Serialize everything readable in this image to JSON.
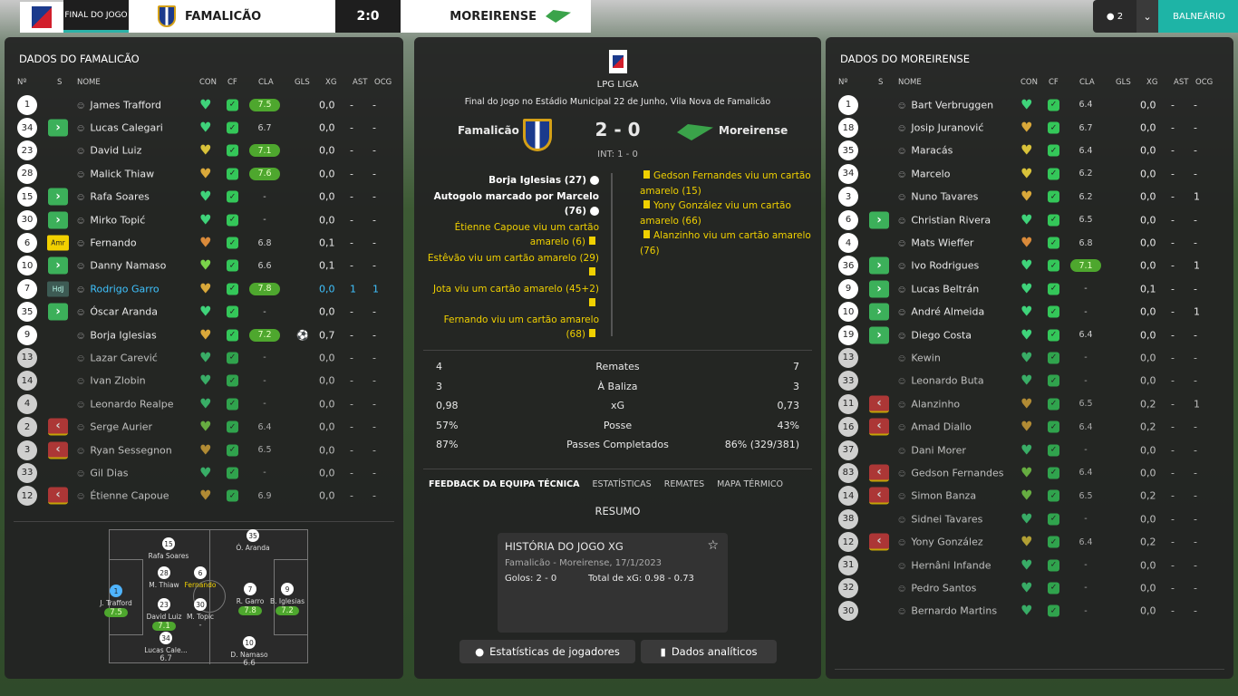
{
  "top": {
    "final_label": "FINAL DO JOGO",
    "home": "FAMALICÃO",
    "score": "2:0",
    "away": "MOREIRENSE",
    "user_count": "2",
    "balneario": "BALNEÁRIO"
  },
  "left": {
    "title": "DADOS DO FAMALICÃO",
    "headers": [
      "Nº",
      "S",
      "NOME",
      "CON",
      "CF",
      "CLA",
      "GLS",
      "XG",
      "AST",
      "OCG"
    ],
    "players": [
      {
        "n": "1",
        "s": "",
        "name": "James Trafford",
        "heart": "#3fd37a",
        "cla": "7.5",
        "g": true,
        "gls": "",
        "xg": "0,0",
        "ast": "-",
        "ocg": "-"
      },
      {
        "n": "34",
        "s": "in",
        "name": "Lucas Calegari",
        "heart": "#3fd37a",
        "cla": "6.7",
        "g": false,
        "gls": "",
        "xg": "0,0",
        "ast": "-",
        "ocg": "-"
      },
      {
        "n": "23",
        "s": "",
        "name": "David Luiz",
        "heart": "#d9c23a",
        "cla": "7.1",
        "g": true,
        "gls": "",
        "xg": "0,0",
        "ast": "-",
        "ocg": "-"
      },
      {
        "n": "28",
        "s": "",
        "name": "Malick Thiaw",
        "heart": "#d9a83a",
        "cla": "7.6",
        "g": true,
        "gls": "",
        "xg": "0,0",
        "ast": "-",
        "ocg": "-"
      },
      {
        "n": "15",
        "s": "in",
        "name": "Rafa Soares",
        "heart": "#3fd37a",
        "cla": "-",
        "g": false,
        "gls": "",
        "xg": "0,0",
        "ast": "-",
        "ocg": "-"
      },
      {
        "n": "30",
        "s": "in",
        "name": "Mirko Topić",
        "heart": "#3fd37a",
        "cla": "-",
        "g": false,
        "gls": "",
        "xg": "0,0",
        "ast": "-",
        "ocg": "-"
      },
      {
        "n": "6",
        "s": "amr",
        "name": "Fernando",
        "heart": "#d98a3a",
        "cla": "6.8",
        "g": false,
        "gls": "",
        "xg": "0,1",
        "ast": "-",
        "ocg": "-"
      },
      {
        "n": "10",
        "s": "in",
        "name": "Danny Namaso",
        "heart": "#7ad34a",
        "cla": "6.6",
        "g": false,
        "gls": "",
        "xg": "0,1",
        "ast": "-",
        "ocg": "-"
      },
      {
        "n": "7",
        "s": "hdj",
        "name": "Rodrigo Garro",
        "heart": "#d9a83a",
        "cla": "7.8",
        "g": true,
        "gls": "",
        "xg": "0,0",
        "ast": "1",
        "ocg": "1",
        "hl": true
      },
      {
        "n": "35",
        "s": "in",
        "name": "Óscar Aranda",
        "heart": "#3fd37a",
        "cla": "-",
        "g": false,
        "gls": "",
        "xg": "0,0",
        "ast": "-",
        "ocg": "-"
      },
      {
        "n": "9",
        "s": "",
        "name": "Borja Iglesias",
        "heart": "#d9a83a",
        "cla": "7.2",
        "g": true,
        "gls": "⚽",
        "xg": "0,7",
        "ast": "-",
        "ocg": "-"
      },
      {
        "n": "13",
        "s": "",
        "name": "Lazar Carević",
        "heart": "#3fd37a",
        "cla": "-",
        "g": false,
        "gls": "",
        "xg": "0,0",
        "ast": "-",
        "ocg": "-",
        "dim": true
      },
      {
        "n": "14",
        "s": "",
        "name": "Ivan Zlobin",
        "heart": "#3fd37a",
        "cla": "-",
        "g": false,
        "gls": "",
        "xg": "0,0",
        "ast": "-",
        "ocg": "-",
        "dim": true
      },
      {
        "n": "4",
        "s": "",
        "name": "Leonardo Realpe",
        "heart": "#3fd37a",
        "cla": "-",
        "g": false,
        "gls": "",
        "xg": "0,0",
        "ast": "-",
        "ocg": "-",
        "dim": true
      },
      {
        "n": "2",
        "s": "out",
        "name": "Serge Aurier",
        "heart": "#7ad34a",
        "cla": "6.4",
        "g": false,
        "gls": "",
        "xg": "0,0",
        "ast": "-",
        "ocg": "-",
        "dim": true
      },
      {
        "n": "3",
        "s": "out",
        "name": "Ryan Sessegnon",
        "heart": "#d9a83a",
        "cla": "6.5",
        "g": false,
        "gls": "",
        "xg": "0,0",
        "ast": "-",
        "ocg": "-",
        "dim": true
      },
      {
        "n": "33",
        "s": "",
        "name": "Gil Dias",
        "heart": "#3fd37a",
        "cla": "-",
        "g": false,
        "gls": "",
        "xg": "0,0",
        "ast": "-",
        "ocg": "-",
        "dim": true
      },
      {
        "n": "12",
        "s": "out",
        "name": "Étienne Capoue",
        "heart": "#d9a83a",
        "cla": "6.9",
        "g": false,
        "gls": "",
        "xg": "0,0",
        "ast": "-",
        "ocg": "-",
        "dim": true
      }
    ],
    "pitch": [
      {
        "n": "1",
        "name": "J. Trafford",
        "r": "7.5",
        "g": true,
        "gk": true
      },
      {
        "n": "15",
        "name": "Rafa Soares",
        "r": "",
        "g": false
      },
      {
        "n": "28",
        "name": "M. Thiaw",
        "r": "",
        "g": false
      },
      {
        "n": "6",
        "name": "Fernando",
        "r": "",
        "g": false,
        "y": true
      },
      {
        "n": "35",
        "name": "Ó. Aranda",
        "r": "",
        "g": false
      },
      {
        "n": "23",
        "name": "David Luiz",
        "r": "7.1",
        "g": true
      },
      {
        "n": "30",
        "name": "M. Topic",
        "r": "-",
        "g": false
      },
      {
        "n": "7",
        "name": "R. Garro",
        "r": "7.8",
        "g": true
      },
      {
        "n": "9",
        "name": "B. Iglesias",
        "r": "7.2",
        "g": true
      },
      {
        "n": "34",
        "name": "Lucas Cale...",
        "r": "6.7",
        "g": false
      },
      {
        "n": "10",
        "name": "D. Namaso",
        "r": "6.6",
        "g": false
      }
    ]
  },
  "mid": {
    "league": "LPG LIGA",
    "venue": "Final do Jogo no Estádio Municipal 22 de Junho, Vila Nova de Famalicão",
    "home": "Famalicão",
    "score": "2 - 0",
    "away": "Moreirense",
    "ht": "INT: 1 - 0",
    "left_events": [
      {
        "text": "Borja Iglesias (27)",
        "type": "goal"
      },
      {
        "text": "Autogolo marcado por Marcelo (76)",
        "type": "og"
      },
      {
        "text": "Étienne Capoue viu um cartão amarelo (6)",
        "type": "y"
      },
      {
        "text": "Estêvão viu um cartão amarelo (29)",
        "type": "y"
      },
      {
        "text": "Jota viu um cartão amarelo (45+2)",
        "type": "y"
      },
      {
        "text": "Fernando viu um cartão amarelo (68)",
        "type": "y"
      }
    ],
    "right_events": [
      {
        "text": "Gedson Fernandes viu um cartão amarelo (15)"
      },
      {
        "text": "Yony González viu um cartão amarelo (66)"
      },
      {
        "text": "Alanzinho viu um cartão amarelo (76)"
      }
    ],
    "stats": [
      {
        "a": "4",
        "m": "Remates",
        "b": "7"
      },
      {
        "a": "3",
        "m": "À Baliza",
        "b": "3"
      },
      {
        "a": "0,98",
        "m": "xG",
        "b": "0,73"
      },
      {
        "a": "57%",
        "m": "Posse",
        "b": "43%"
      },
      {
        "a": "87%",
        "m": "Passes Completados",
        "b": "86% (329/381)"
      }
    ],
    "tabs": [
      "FEEDBACK DA EQUIPA TÉCNICA",
      "ESTATÍSTICAS",
      "REMATES",
      "MAPA TÉRMICO"
    ],
    "resumo": "RESUMO",
    "card": {
      "title": "HISTÓRIA DO JOGO XG",
      "sub": "Famalicão - Moreirense, 17/1/2023",
      "goals": "Golos: 2 - 0",
      "xg": "Total de xG: 0.98 - 0.73"
    },
    "btn1": "Estatísticas de jogadores",
    "btn2": "Dados analíticos"
  },
  "right": {
    "title": "DADOS DO MOREIRENSE",
    "players": [
      {
        "n": "1",
        "s": "",
        "name": "Bart Verbruggen",
        "heart": "#3fd37a",
        "cla": "6.4",
        "g": false,
        "xg": "0,0",
        "ast": "-",
        "ocg": "-"
      },
      {
        "n": "18",
        "s": "",
        "name": "Josip Juranović",
        "heart": "#d9a83a",
        "cla": "6.7",
        "g": false,
        "xg": "0,0",
        "ast": "-",
        "ocg": "-"
      },
      {
        "n": "35",
        "s": "",
        "name": "Maracás",
        "heart": "#d9c23a",
        "cla": "6.4",
        "g": false,
        "xg": "0,0",
        "ast": "-",
        "ocg": "-"
      },
      {
        "n": "34",
        "s": "",
        "name": "Marcelo",
        "heart": "#d9c23a",
        "cla": "6.2",
        "g": false,
        "xg": "0,0",
        "ast": "-",
        "ocg": "-"
      },
      {
        "n": "3",
        "s": "",
        "name": "Nuno Tavares",
        "heart": "#d9a83a",
        "cla": "6.2",
        "g": false,
        "xg": "0,0",
        "ast": "-",
        "ocg": "1"
      },
      {
        "n": "6",
        "s": "in",
        "name": "Christian Rivera",
        "heart": "#3fd37a",
        "cla": "6.5",
        "g": false,
        "xg": "0,0",
        "ast": "-",
        "ocg": "-"
      },
      {
        "n": "4",
        "s": "",
        "name": "Mats Wieffer",
        "heart": "#d98a3a",
        "cla": "6.8",
        "g": false,
        "xg": "0,0",
        "ast": "-",
        "ocg": "-"
      },
      {
        "n": "36",
        "s": "in",
        "name": "Ivo Rodrigues",
        "heart": "#3fd37a",
        "cla": "7.1",
        "g": true,
        "xg": "0,0",
        "ast": "-",
        "ocg": "1"
      },
      {
        "n": "9",
        "s": "in",
        "name": "Lucas Beltrán",
        "heart": "#3fd37a",
        "cla": "-",
        "g": false,
        "xg": "0,1",
        "ast": "-",
        "ocg": "-"
      },
      {
        "n": "10",
        "s": "in",
        "name": "André Almeida",
        "heart": "#3fd37a",
        "cla": "-",
        "g": false,
        "xg": "0,0",
        "ast": "-",
        "ocg": "1"
      },
      {
        "n": "19",
        "s": "in",
        "name": "Diego Costa",
        "heart": "#3fd37a",
        "cla": "6.4",
        "g": false,
        "xg": "0,0",
        "ast": "-",
        "ocg": "-"
      },
      {
        "n": "13",
        "s": "",
        "name": "Kewin",
        "heart": "#3fd37a",
        "cla": "-",
        "g": false,
        "xg": "0,0",
        "ast": "-",
        "ocg": "-",
        "dim": true
      },
      {
        "n": "33",
        "s": "",
        "name": "Leonardo Buta",
        "heart": "#3fd37a",
        "cla": "-",
        "g": false,
        "xg": "0,0",
        "ast": "-",
        "ocg": "-",
        "dim": true
      },
      {
        "n": "11",
        "s": "out",
        "name": "Alanzinho",
        "heart": "#d9a83a",
        "cla": "6.5",
        "g": false,
        "xg": "0,2",
        "ast": "-",
        "ocg": "1",
        "dim": true
      },
      {
        "n": "16",
        "s": "out",
        "name": "Amad Diallo",
        "heart": "#d9a83a",
        "cla": "6.4",
        "g": false,
        "xg": "0,2",
        "ast": "-",
        "ocg": "-",
        "dim": true
      },
      {
        "n": "37",
        "s": "",
        "name": "Dani Morer",
        "heart": "#3fd37a",
        "cla": "-",
        "g": false,
        "xg": "0,0",
        "ast": "-",
        "ocg": "-",
        "dim": true
      },
      {
        "n": "83",
        "s": "out",
        "name": "Gedson Fernandes",
        "heart": "#7ad34a",
        "cla": "6.4",
        "g": false,
        "xg": "0,0",
        "ast": "-",
        "ocg": "-",
        "dim": true
      },
      {
        "n": "14",
        "s": "out",
        "name": "Simon Banza",
        "heart": "#7ad34a",
        "cla": "6.5",
        "g": false,
        "xg": "0,2",
        "ast": "-",
        "ocg": "-",
        "dim": true
      },
      {
        "n": "38",
        "s": "",
        "name": "Sidnei Tavares",
        "heart": "#3fd37a",
        "cla": "-",
        "g": false,
        "xg": "0,0",
        "ast": "-",
        "ocg": "-",
        "dim": true
      },
      {
        "n": "12",
        "s": "out",
        "name": "Yony González",
        "heart": "#d9c23a",
        "cla": "6.4",
        "g": false,
        "xg": "0,2",
        "ast": "-",
        "ocg": "-",
        "dim": true
      },
      {
        "n": "31",
        "s": "",
        "name": "Hernâni Infande",
        "heart": "#3fd37a",
        "cla": "-",
        "g": false,
        "xg": "0,0",
        "ast": "-",
        "ocg": "-",
        "dim": true
      },
      {
        "n": "32",
        "s": "",
        "name": "Pedro Santos",
        "heart": "#3fd37a",
        "cla": "-",
        "g": false,
        "xg": "0,0",
        "ast": "-",
        "ocg": "-",
        "dim": true
      },
      {
        "n": "30",
        "s": "",
        "name": "Bernardo Martins",
        "heart": "#3fd37a",
        "cla": "-",
        "g": false,
        "xg": "0,0",
        "ast": "-",
        "ocg": "-",
        "dim": true
      }
    ]
  }
}
